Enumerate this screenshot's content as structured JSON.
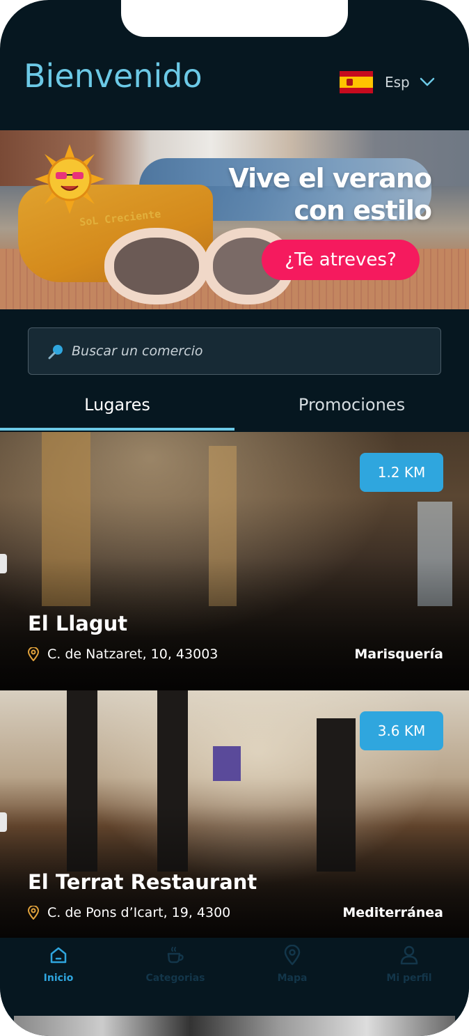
{
  "header": {
    "title": "Bienvenido",
    "language": {
      "label": "Esp",
      "flag_icon": "spain-flag-icon"
    }
  },
  "banner": {
    "headline_line1": "Vive el verano",
    "headline_line2": "con estilo",
    "cta_label": "¿Te atreves?",
    "logo_text": "SoL Creciente",
    "cta_color": "#f51a5e"
  },
  "search": {
    "placeholder": "Buscar un comercio"
  },
  "tabs": [
    {
      "label": "Lugares",
      "active": true
    },
    {
      "label": "Promociones",
      "active": false
    }
  ],
  "places": [
    {
      "distance": "1.2 KM",
      "name": "El Llagut",
      "address": "C. de Natzaret, 10, 43003",
      "category": "Marisquería"
    },
    {
      "distance": "3.6 KM",
      "name": "El Terrat Restaurant",
      "address": "C. de Pons d’Icart, 19, 4300",
      "category": "Mediterránea"
    }
  ],
  "bottom_nav": [
    {
      "label": "Inicio",
      "icon": "home-icon",
      "active": true
    },
    {
      "label": "Categorias",
      "icon": "coffee-cup-icon",
      "active": false
    },
    {
      "label": "Mapa",
      "icon": "map-pin-icon",
      "active": false
    },
    {
      "label": "Mi perfil",
      "icon": "user-icon",
      "active": false
    }
  ],
  "colors": {
    "accent": "#6cc9e6",
    "badge": "#2fa6de",
    "background": "#061720"
  }
}
